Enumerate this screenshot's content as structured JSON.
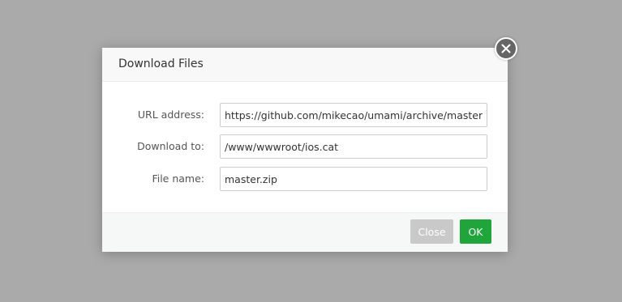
{
  "dialog": {
    "title": "Download Files",
    "close_icon": "close-icon",
    "fields": [
      {
        "label": "URL address:",
        "value": "https://github.com/mikecao/umami/archive/master.zip"
      },
      {
        "label": "Download to:",
        "value": "/www/wwwroot/ios.cat"
      },
      {
        "label": "File name:",
        "value": "master.zip"
      }
    ],
    "buttons": {
      "close_label": "Close",
      "ok_label": "OK"
    }
  },
  "colors": {
    "overlay": "#aaaaaa",
    "ok_button": "#20a53a",
    "close_button": "#c9c9c9",
    "close_icon_bg": "#666666"
  }
}
